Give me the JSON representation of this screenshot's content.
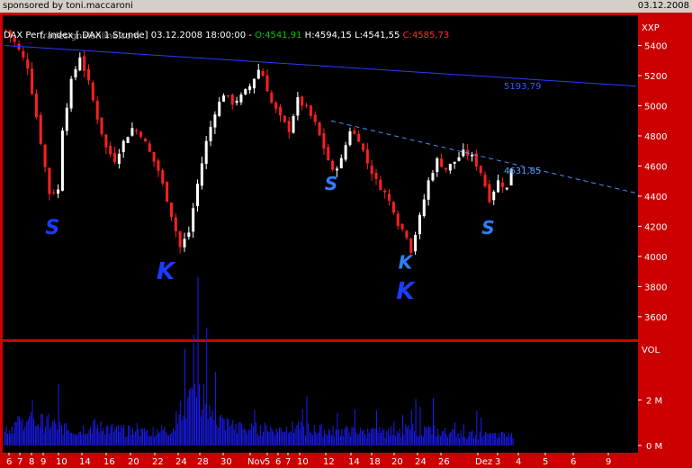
{
  "header": {
    "sponsor": "sponsored by toni.maccaroni",
    "date": "03.12.2008"
  },
  "ohlc": {
    "title": "DAX Perf. Index [.DAX  1 Stunde] 03.12.2008 18:00:00",
    "open": "O:4541,91",
    "high": "H:4594,15",
    "low": "L:4541,55",
    "close": "C:4585,73"
  },
  "watermark": "tradesignalonline.com",
  "colors": {
    "background": "#000000",
    "frame": "#cc0000",
    "up_candle": "#ffffff",
    "down_candle": "#ff2020",
    "trendline": "#2a3cff",
    "dashed_trendline": "#4a90ff",
    "volume": "#1b1bff",
    "open_value": "#00cc00",
    "close_value": "#ff3030"
  },
  "chart_data": [
    {
      "type": "candlestick",
      "title": "DAX Perf. Index [.DAX  1 Stunde]",
      "ylabel": "XXP",
      "ylim": [
        3450,
        5600
      ],
      "yticks": [
        3600,
        3800,
        4000,
        4200,
        4400,
        4600,
        4800,
        5000,
        5200,
        5400
      ],
      "xticks": [
        "6",
        "7",
        "8",
        "9",
        "10",
        "14",
        "16",
        "20",
        "22",
        "24",
        "28",
        "30",
        "Nov",
        "5",
        "6",
        "7",
        "10",
        "12",
        "14",
        "18",
        "20",
        "24",
        "26",
        "Dez",
        "3",
        "4",
        "5",
        "6",
        "9"
      ],
      "close_path": [
        {
          "x": 0,
          "y": 5500
        },
        {
          "x": 2,
          "y": 5420
        },
        {
          "x": 5,
          "y": 5260
        },
        {
          "x": 8,
          "y": 4760
        },
        {
          "x": 10,
          "y": 4420
        },
        {
          "x": 12,
          "y": 4440
        },
        {
          "x": 13,
          "y": 4850
        },
        {
          "x": 15,
          "y": 5160
        },
        {
          "x": 17,
          "y": 5330
        },
        {
          "x": 19,
          "y": 5150
        },
        {
          "x": 21,
          "y": 4920
        },
        {
          "x": 23,
          "y": 4720
        },
        {
          "x": 25,
          "y": 4640
        },
        {
          "x": 27,
          "y": 4760
        },
        {
          "x": 29,
          "y": 4850
        },
        {
          "x": 31,
          "y": 4810
        },
        {
          "x": 33,
          "y": 4690
        },
        {
          "x": 35,
          "y": 4570
        },
        {
          "x": 37,
          "y": 4380
        },
        {
          "x": 39,
          "y": 4170
        },
        {
          "x": 40,
          "y": 4060
        },
        {
          "x": 42,
          "y": 4160
        },
        {
          "x": 44,
          "y": 4480
        },
        {
          "x": 46,
          "y": 4760
        },
        {
          "x": 48,
          "y": 4960
        },
        {
          "x": 50,
          "y": 5080
        },
        {
          "x": 52,
          "y": 5020
        },
        {
          "x": 54,
          "y": 5060
        },
        {
          "x": 56,
          "y": 5130
        },
        {
          "x": 58,
          "y": 5240
        },
        {
          "x": 59,
          "y": 5200
        },
        {
          "x": 61,
          "y": 5020
        },
        {
          "x": 63,
          "y": 4920
        },
        {
          "x": 65,
          "y": 4840
        },
        {
          "x": 67,
          "y": 5040
        },
        {
          "x": 69,
          "y": 4980
        },
        {
          "x": 71,
          "y": 4880
        },
        {
          "x": 73,
          "y": 4720
        },
        {
          "x": 75,
          "y": 4560
        },
        {
          "x": 77,
          "y": 4640
        },
        {
          "x": 79,
          "y": 4840
        },
        {
          "x": 81,
          "y": 4780
        },
        {
          "x": 83,
          "y": 4620
        },
        {
          "x": 85,
          "y": 4500
        },
        {
          "x": 87,
          "y": 4420
        },
        {
          "x": 89,
          "y": 4310
        },
        {
          "x": 90,
          "y": 4220
        },
        {
          "x": 92,
          "y": 4140
        },
        {
          "x": 93,
          "y": 4040
        },
        {
          "x": 95,
          "y": 4260
        },
        {
          "x": 97,
          "y": 4500
        },
        {
          "x": 99,
          "y": 4640
        },
        {
          "x": 101,
          "y": 4580
        },
        {
          "x": 103,
          "y": 4630
        },
        {
          "x": 105,
          "y": 4690
        },
        {
          "x": 107,
          "y": 4660
        },
        {
          "x": 109,
          "y": 4560
        },
        {
          "x": 111,
          "y": 4380
        },
        {
          "x": 113,
          "y": 4500
        },
        {
          "x": 115,
          "y": 4450
        },
        {
          "x": 116,
          "y": 4590
        }
      ],
      "trendlines": [
        {
          "style": "solid",
          "label": "5193,79",
          "from": {
            "x": 0,
            "y": 5400
          },
          "to": {
            "x": 145,
            "y": 5130
          }
        },
        {
          "style": "dashed",
          "label": "4631,85",
          "from": {
            "x": 75,
            "y": 4900
          },
          "to": {
            "x": 145,
            "y": 4420
          }
        }
      ],
      "annotations": [
        {
          "text": "S",
          "x": 11,
          "y": 4150,
          "size": 22
        },
        {
          "text": "K",
          "x": 37,
          "y": 3850,
          "size": 26
        },
        {
          "text": "S",
          "x": 75,
          "y": 4440,
          "size": 20
        },
        {
          "text": "K",
          "x": 92,
          "y": 3920,
          "size": 20
        },
        {
          "text": "K",
          "x": 92,
          "y": 3720,
          "size": 26
        },
        {
          "text": "S",
          "x": 111,
          "y": 4150,
          "size": 20
        }
      ]
    },
    {
      "type": "bar",
      "title": "Volume",
      "ylabel": "VOL",
      "yticks": [
        {
          "label": "0 M",
          "value": 0
        },
        {
          "label": "2 M",
          "value": 2000000
        }
      ],
      "ylim": [
        0,
        4300000
      ],
      "volume_profile": [
        {
          "x": 0,
          "v": 1100000
        },
        {
          "x": 5,
          "v": 1500000
        },
        {
          "x": 10,
          "v": 1400000
        },
        {
          "x": 15,
          "v": 900000
        },
        {
          "x": 20,
          "v": 1200000
        },
        {
          "x": 30,
          "v": 800000
        },
        {
          "x": 38,
          "v": 1000000
        },
        {
          "x": 43,
          "v": 3800000
        },
        {
          "x": 46,
          "v": 2300000
        },
        {
          "x": 50,
          "v": 1400000
        },
        {
          "x": 55,
          "v": 1000000
        },
        {
          "x": 65,
          "v": 1100000
        },
        {
          "x": 75,
          "v": 900000
        },
        {
          "x": 85,
          "v": 800000
        },
        {
          "x": 95,
          "v": 1000000
        },
        {
          "x": 105,
          "v": 700000
        },
        {
          "x": 116,
          "v": 600000
        }
      ]
    }
  ]
}
